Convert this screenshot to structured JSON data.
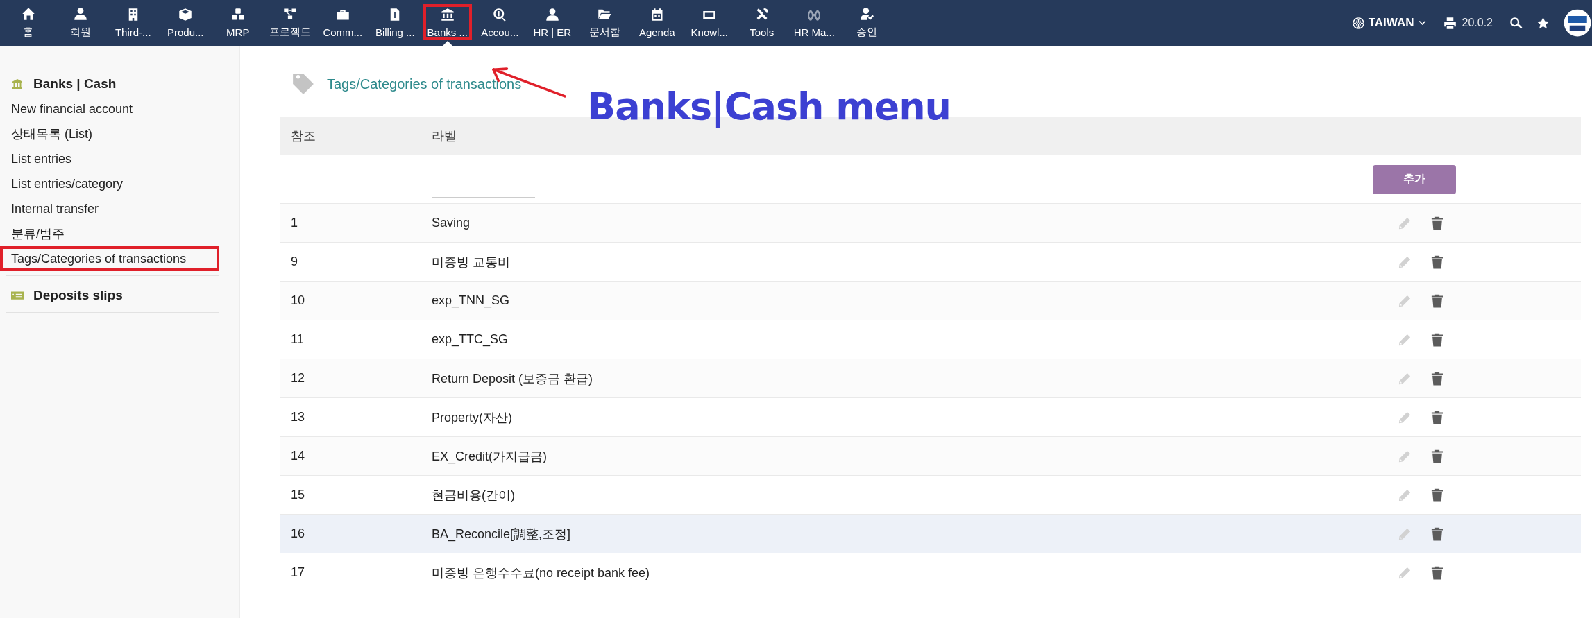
{
  "top_menu": [
    {
      "label": "홈",
      "selected": false,
      "marked": false
    },
    {
      "label": "회원",
      "selected": false,
      "marked": false
    },
    {
      "label": "Third-...",
      "selected": false,
      "marked": false
    },
    {
      "label": "Produ...",
      "selected": false,
      "marked": false
    },
    {
      "label": "MRP",
      "selected": false,
      "marked": false
    },
    {
      "label": "프로젝트",
      "selected": false,
      "marked": false
    },
    {
      "label": "Comm...",
      "selected": false,
      "marked": false
    },
    {
      "label": "Billing ...",
      "selected": false,
      "marked": false
    },
    {
      "label": "Banks ...",
      "selected": true,
      "marked": true
    },
    {
      "label": "Accou...",
      "selected": false,
      "marked": false
    },
    {
      "label": "HR | ER",
      "selected": false,
      "marked": false
    },
    {
      "label": "문서함",
      "selected": false,
      "marked": false
    },
    {
      "label": "Agenda",
      "selected": false,
      "marked": false
    },
    {
      "label": "Knowl...",
      "selected": false,
      "marked": false
    },
    {
      "label": "Tools",
      "selected": false,
      "marked": false
    },
    {
      "label": "HR Ma...",
      "selected": false,
      "marked": false
    },
    {
      "label": "승인",
      "selected": false,
      "marked": false
    }
  ],
  "top_right": {
    "country": "TAIWAN",
    "version": "20.0.2"
  },
  "sidebar": {
    "sections": [
      {
        "title": "Banks | Cash",
        "items": [
          {
            "label": "New financial account",
            "marked": false
          },
          {
            "label": "상태목록 (List)",
            "marked": false
          },
          {
            "label": "List entries",
            "marked": false
          },
          {
            "label": "List entries/category",
            "marked": false
          },
          {
            "label": "Internal transfer",
            "marked": false
          },
          {
            "label": "분류/범주",
            "marked": false
          },
          {
            "label": "Tags/Categories of transactions",
            "marked": true
          }
        ]
      },
      {
        "title": "Deposits slips"
      }
    ]
  },
  "page_title": "Tags/Categories of transactions",
  "annotation": {
    "text": "Banks|Cash menu"
  },
  "table": {
    "columns": [
      "참조",
      "라벨"
    ],
    "add_button": "추가",
    "rows": [
      {
        "ref": "1",
        "label": "Saving",
        "highlighted": false
      },
      {
        "ref": "9",
        "label": "미증빙 교통비",
        "highlighted": false
      },
      {
        "ref": "10",
        "label": "exp_TNN_SG",
        "highlighted": false
      },
      {
        "ref": "11",
        "label": "exp_TTC_SG",
        "highlighted": false
      },
      {
        "ref": "12",
        "label": "Return Deposit (보증금 환급)",
        "highlighted": false
      },
      {
        "ref": "13",
        "label": "Property(자산)",
        "highlighted": false
      },
      {
        "ref": "14",
        "label": "EX_Credit(가지급금)",
        "highlighted": false
      },
      {
        "ref": "15",
        "label": "현금비용(간이)",
        "highlighted": false
      },
      {
        "ref": "16",
        "label": "BA_Reconcile[調整,조정]",
        "highlighted": true
      },
      {
        "ref": "17",
        "label": "미증빙 은행수수료(no receipt bank fee)",
        "highlighted": false
      }
    ]
  }
}
